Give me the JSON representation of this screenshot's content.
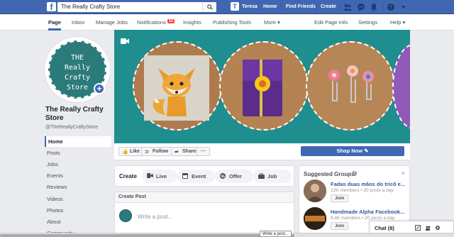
{
  "topbar": {
    "search_value": "The Really Crafty Store",
    "user_name": "Teresa",
    "user_initial": "T",
    "nav": [
      "Home",
      "Find Friends",
      "Create"
    ]
  },
  "subnav": {
    "items": [
      "Page",
      "Inbox",
      "Manage Jobs",
      "Notifications",
      "Insights",
      "Publishing Tools",
      "More ▾"
    ],
    "notifications_badge": "11",
    "right_items": [
      "Edit Page Info",
      "Settings",
      "Help ▾"
    ]
  },
  "profile": {
    "logo_lines": [
      "THE",
      "Really Crafty",
      "Store"
    ],
    "page_name": "The Really Crafty Store",
    "handle": "@TheReallyCraftyStore"
  },
  "left_nav": [
    "Home",
    "Posts",
    "Jobs",
    "Events",
    "Reviews",
    "Videos",
    "Photos",
    "About",
    "Community"
  ],
  "actions": {
    "like": "Like",
    "follow": "Follow",
    "share": "Share",
    "more": "···",
    "shop_now": "Shop Now"
  },
  "create": {
    "label": "Create",
    "buttons": [
      "Live",
      "Event",
      "Offer",
      "Job"
    ]
  },
  "post": {
    "header": "Create Post",
    "placeholder": "Write a post..."
  },
  "suggested_groups": {
    "title": "Suggested Groups",
    "groups": [
      {
        "name": "Fadas duas mãos do tricô e...",
        "meta": "12K members • 30 posts a day",
        "join": "Join"
      },
      {
        "name": "Handmade Alpha Facebook...",
        "meta": "8.4K members • 20 posts a day",
        "join": "Join"
      }
    ]
  },
  "chat": {
    "label": "Chat (8)"
  },
  "tooltip": "Write a post...",
  "colors": {
    "brand": "#4267b2",
    "cover": "#1e8e8e",
    "logo_bg": "#2b7b7b"
  }
}
